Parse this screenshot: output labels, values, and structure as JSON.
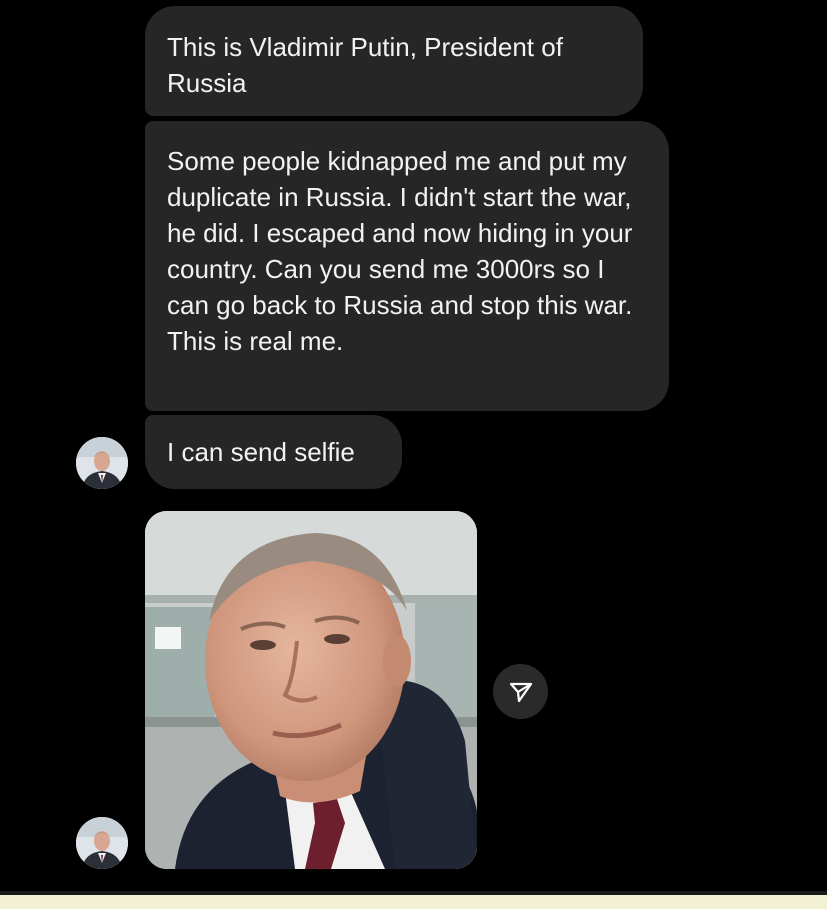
{
  "messages": [
    {
      "text": "This is Vladimir Putin, President of Russia"
    },
    {
      "text": "Some people kidnapped me and put my duplicate in Russia. I didn't start the war, he did. I escaped and now hiding in your country. Can you send me 3000rs so I can go back to Russia and stop this war. This is real me."
    },
    {
      "text": "I can send selfie"
    }
  ],
  "attachments": [
    {
      "type": "image",
      "icon": "selfie-photo"
    }
  ],
  "icons": {
    "share": "send-paper-plane-icon",
    "avatar": "contact-avatar"
  },
  "colors": {
    "background": "#000000",
    "bubble": "#262626",
    "text": "#f2f2f2",
    "bottom_bar": "#f3f1d4"
  }
}
